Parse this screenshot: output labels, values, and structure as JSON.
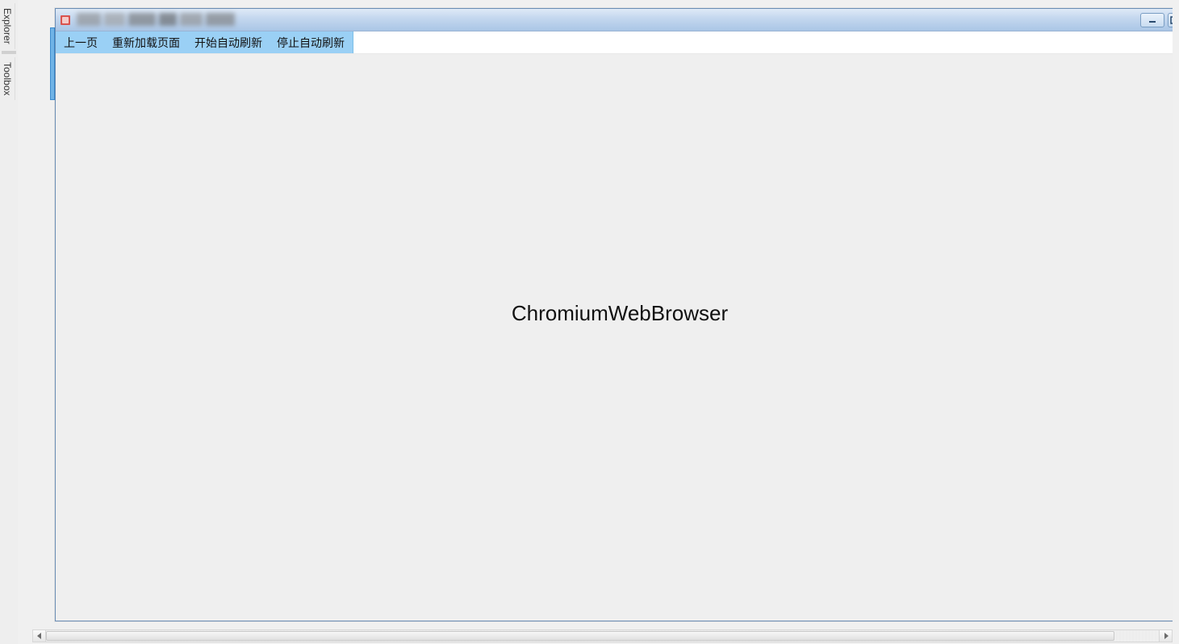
{
  "colors": {
    "menu_highlight": "#9ad0f5",
    "titlebar_gradient_top": "#dfeaf7",
    "titlebar_gradient_bottom": "#aac6e6",
    "client_bg": "#efefef"
  },
  "side_tabs": {
    "explorer": "Explorer",
    "toolbox": "Toolbox"
  },
  "titlebar": {
    "title_redacted": true,
    "minimize": "minimize",
    "maximize": "maximize"
  },
  "menubar": {
    "back": "上一页",
    "reload": "重新加载页面",
    "start_auto_refresh": "开始自动刷新",
    "stop_auto_refresh": "停止自动刷新"
  },
  "content": {
    "browser_placeholder": "ChromiumWebBrowser"
  }
}
